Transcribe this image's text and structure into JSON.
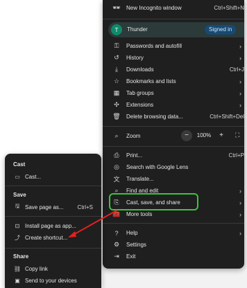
{
  "menu": {
    "items_top": [
      {
        "label": "New Incognito window",
        "shortcut": "Ctrl+Shift+N",
        "icon": "incognito-icon"
      }
    ],
    "profile": {
      "name": "Thunder",
      "avatar_letter": "T",
      "badge": "Signed in"
    },
    "items_main": [
      {
        "label": "Passwords and autofill",
        "icon": "key-icon",
        "arrow": "›"
      },
      {
        "label": "History",
        "icon": "history-icon",
        "arrow": "›"
      },
      {
        "label": "Downloads",
        "icon": "download-icon",
        "shortcut": "Ctrl+J"
      },
      {
        "label": "Bookmarks and lists",
        "icon": "star-icon",
        "arrow": "›"
      },
      {
        "label": "Tab groups",
        "icon": "tab-groups-icon",
        "arrow": "›"
      },
      {
        "label": "Extensions",
        "icon": "puzzle-icon",
        "arrow": "›"
      },
      {
        "label": "Delete browsing data...",
        "icon": "trash-icon",
        "shortcut": "Ctrl+Shift+Del"
      }
    ],
    "zoom": {
      "label": "Zoom",
      "minus": "−",
      "value": "100%",
      "plus": "+",
      "fullscreen": "⛶"
    },
    "items_bottom": [
      {
        "label": "Print...",
        "icon": "printer-icon",
        "shortcut": "Ctrl+P"
      },
      {
        "label": "Search with Google Lens",
        "icon": "lens-icon"
      },
      {
        "label": "Translate...",
        "icon": "translate-icon"
      },
      {
        "label": "Find and edit",
        "icon": "find-icon",
        "arrow": "›"
      },
      {
        "label": "Cast, save, and share",
        "icon": "cast-save-share-icon",
        "arrow": "›"
      },
      {
        "label": "More tools",
        "icon": "tools-icon",
        "arrow": "›"
      }
    ],
    "items_help": [
      {
        "label": "Help",
        "icon": "help-icon",
        "arrow": "›"
      },
      {
        "label": "Settings",
        "icon": "gear-icon"
      },
      {
        "label": "Exit",
        "icon": "exit-icon"
      }
    ]
  },
  "submenu": {
    "sections": [
      {
        "header": "Cast",
        "items": [
          {
            "label": "Cast...",
            "icon": "cast-icon"
          }
        ]
      },
      {
        "header": "Save",
        "items": [
          {
            "label": "Save page as...",
            "icon": "save-icon",
            "shortcut": "Ctrl+S"
          }
        ]
      },
      {
        "header": "",
        "items": [
          {
            "label": "Install page as app...",
            "icon": "install-icon"
          },
          {
            "label": "Create shortcut...",
            "icon": "shortcut-icon"
          }
        ]
      },
      {
        "header": "Share",
        "items": [
          {
            "label": "Copy link",
            "icon": "link-icon"
          },
          {
            "label": "Send to your devices",
            "icon": "devices-icon"
          }
        ]
      }
    ]
  },
  "colors": {
    "highlight": "#3ec43e",
    "annotation_arrow": "#e32020",
    "menu_bg": "#1f1f1f",
    "badge_bg": "#164a72"
  }
}
